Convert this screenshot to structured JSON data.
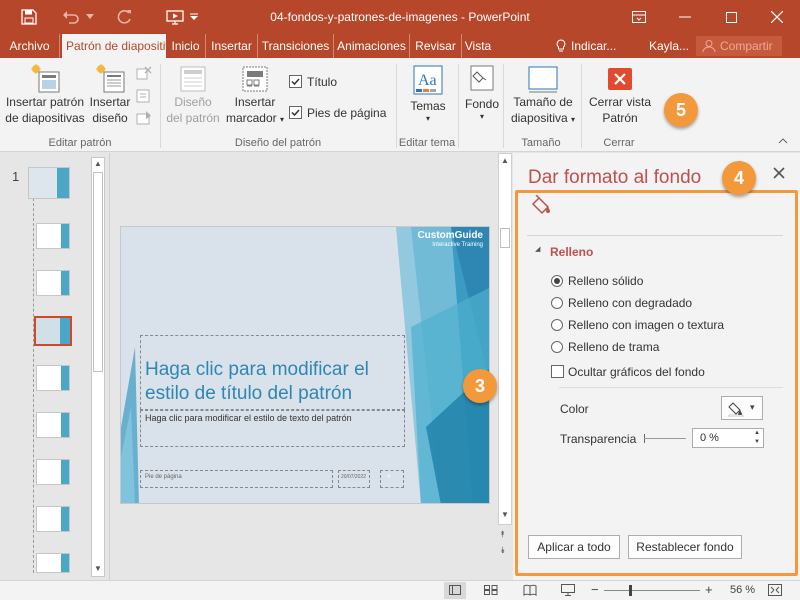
{
  "title_bar": {
    "doc_title": "04-fondos-y-patrones-de-imagenes - PowerPoint"
  },
  "tabs": {
    "archivo": "Archivo",
    "patron": "Patrón de diapositiva",
    "inicio": "Inicio",
    "insertar": "Insertar",
    "transiciones": "Transiciones",
    "animaciones": "Animaciones",
    "revisar": "Revisar",
    "vista": "Vista",
    "indicar": "Indicar...",
    "user": "Kayla...",
    "compartir": "Compartir"
  },
  "ribbon": {
    "insert_master_1": "Insertar patrón",
    "insert_master_2": "de diapositivas",
    "insert_layout_1": "Insertar",
    "insert_layout_2": "diseño",
    "group_edit": "Editar patrón",
    "master_layout_1": "Diseño",
    "master_layout_2": "del patrón",
    "insert_placeholder_1": "Insertar",
    "insert_placeholder_2": "marcador",
    "chk_title": "Título",
    "chk_footer": "Pies de página",
    "group_layout": "Diseño del patrón",
    "themes": "Temas",
    "group_theme": "Editar tema",
    "background": "Fondo",
    "slide_size_1": "Tamaño de",
    "slide_size_2": "diapositiva",
    "group_size": "Tamaño",
    "close_view_1": "Cerrar vista",
    "close_view_2": "Patrón",
    "group_close": "Cerrar"
  },
  "thumbs": {
    "slide_number": "1"
  },
  "slide": {
    "logo_main": "CustomGuide",
    "logo_sub": "Interactive Training",
    "title": "Haga clic para modificar el estilo de título del patrón",
    "body": "Haga clic para modificar el estilo de texto del patrón",
    "footer": "Pie de página",
    "date": "20/07/2022",
    "number": "#"
  },
  "format_pane": {
    "title": "Dar formato al fondo",
    "section": "Relleno",
    "options": [
      "Relleno sólido",
      "Relleno con degradado",
      "Relleno con imagen o textura",
      "Relleno de trama"
    ],
    "selected_option": "Relleno sólido",
    "hide_graphics": "Ocultar gráficos del fondo",
    "hide_graphics_checked": false,
    "color_label": "Color",
    "transparency_label": "Transparencia",
    "transparency_value": "0 %",
    "apply_all": "Aplicar a todo",
    "reset": "Restablecer fondo"
  },
  "callouts": {
    "three": "3",
    "four": "4",
    "five": "5"
  },
  "status": {
    "zoom": "56 %"
  },
  "colors": {
    "accent": "#b7472a",
    "callout": "#f3993c",
    "close_icon": "#e04a2f"
  }
}
